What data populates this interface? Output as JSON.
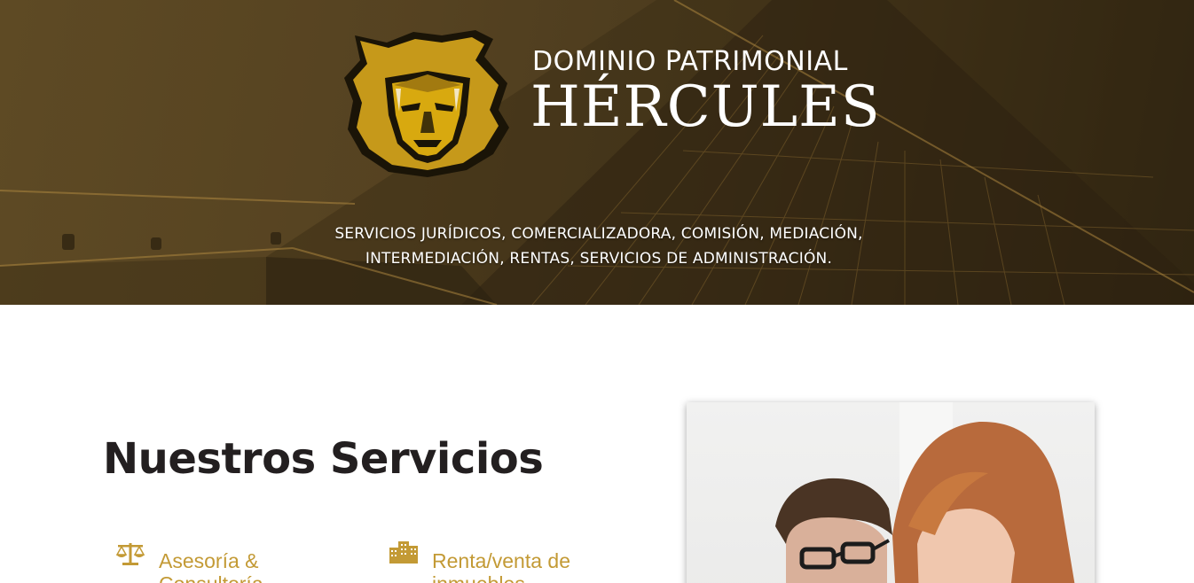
{
  "hero": {
    "brand_top": "DOMINIO PATRIMONIAL",
    "brand_main": "HÉRCULES",
    "tagline_line1": "SERVICIOS JURÍDICOS, COMERCIALIZADORA, COMISIÓN, MEDIACIÓN,",
    "tagline_line2": "INTERMEDIACIÓN, RENTAS, SERVICIOS DE ADMINISTRACIÓN."
  },
  "services": {
    "title": "Nuestros Servicios",
    "items": [
      {
        "icon": "scales-icon",
        "label": "Asesoría & Consultoría"
      },
      {
        "icon": "buildings-icon",
        "label": "Renta/venta de inmuebles"
      }
    ]
  },
  "colors": {
    "accent": "#c39a35",
    "title": "#231f20",
    "hero_tint": "#554221"
  }
}
